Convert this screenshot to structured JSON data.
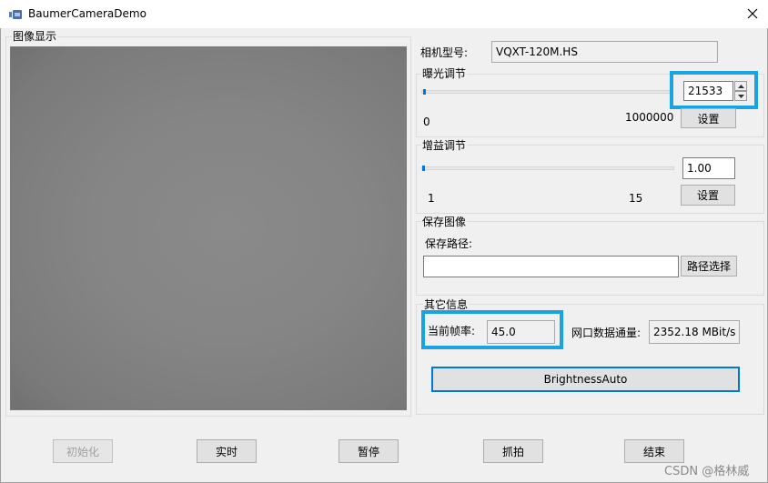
{
  "window": {
    "title": "BaumerCameraDemo"
  },
  "image_group": {
    "label": "图像显示"
  },
  "camera": {
    "model_label": "相机型号:",
    "model_value": "VQXT-120M.HS"
  },
  "exposure": {
    "group_label": "曝光调节",
    "value": "21533",
    "min_label": "0",
    "max_label": "1000000",
    "slider_fraction": 0.021533,
    "set_button": "设置"
  },
  "gain": {
    "group_label": "增益调节",
    "value": "1.00",
    "min_label": "1",
    "max_label": "15",
    "set_button": "设置"
  },
  "save": {
    "group_label": "保存图像",
    "path_label": "保存路径:",
    "path_value": "",
    "choose_button": "路径选择"
  },
  "info": {
    "group_label": "其它信息",
    "fps_label": "当前帧率:",
    "fps_value": "45.0",
    "throughput_label": "网口数据通量:",
    "throughput_value": "2352.18 MBit/s",
    "brightness_button": "BrightnessAuto"
  },
  "bottom_buttons": {
    "init": "初始化",
    "live": "实时",
    "pause": "暂停",
    "capture": "抓拍",
    "end": "结束"
  },
  "watermark": "CSDN @格林威",
  "colors": {
    "highlight": "#19a3e0",
    "accent": "#0078d7"
  }
}
